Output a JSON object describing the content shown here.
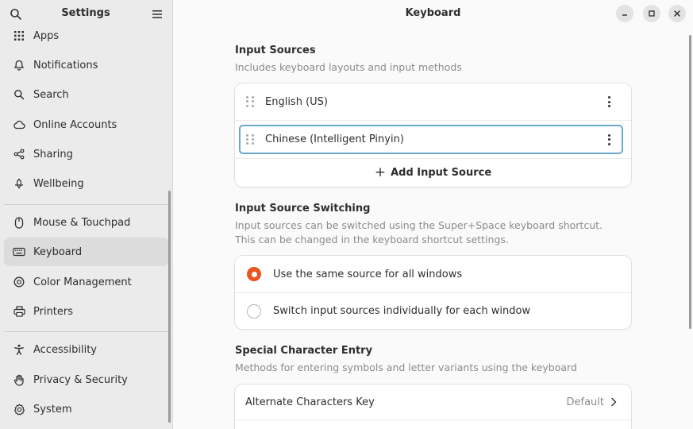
{
  "sidebar": {
    "title": "Settings",
    "items": [
      {
        "label": "Apps",
        "icon": "apps-grid-icon"
      },
      {
        "label": "Notifications",
        "icon": "bell-icon"
      },
      {
        "label": "Search",
        "icon": "search-icon"
      },
      {
        "label": "Online Accounts",
        "icon": "cloud-icon"
      },
      {
        "label": "Sharing",
        "icon": "share-icon"
      },
      {
        "label": "Wellbeing",
        "icon": "wellbeing-icon"
      },
      {
        "label": "Mouse & Touchpad",
        "icon": "mouse-icon"
      },
      {
        "label": "Keyboard",
        "icon": "keyboard-icon",
        "active": true
      },
      {
        "label": "Color Management",
        "icon": "color-icon"
      },
      {
        "label": "Printers",
        "icon": "printer-icon"
      },
      {
        "label": "Accessibility",
        "icon": "accessibility-icon"
      },
      {
        "label": "Privacy & Security",
        "icon": "hand-icon"
      },
      {
        "label": "System",
        "icon": "gear-icon"
      }
    ]
  },
  "header": {
    "title": "Keyboard"
  },
  "input_sources": {
    "title": "Input Sources",
    "description": "Includes keyboard layouts and input methods",
    "sources": [
      "English (US)",
      "Chinese (Intelligent Pinyin)"
    ],
    "add_label": "Add Input Source"
  },
  "switching": {
    "title": "Input Source Switching",
    "description_line1": "Input sources can be switched using the Super+Space keyboard shortcut.",
    "description_line2": "This can be changed in the keyboard shortcut settings.",
    "options": [
      {
        "label": "Use the same source for all windows",
        "selected": true
      },
      {
        "label": "Switch input sources individually for each window",
        "selected": false
      }
    ]
  },
  "special": {
    "title": "Special Character Entry",
    "description": "Methods for entering symbols and letter variants using the keyboard",
    "rows": [
      {
        "label": "Alternate Characters Key",
        "value": "Default"
      }
    ]
  },
  "colors": {
    "accent": "#e95420",
    "focus": "#6aa9c9",
    "sidebar_bg": "#ebebeb",
    "active_item": "#dcdcdc"
  }
}
